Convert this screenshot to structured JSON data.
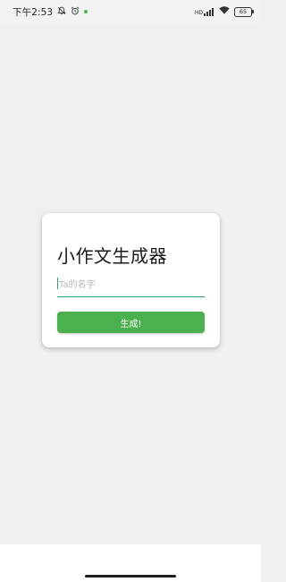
{
  "status_bar": {
    "time": "下午2:53",
    "network_label": "HD",
    "battery_level": "65",
    "icons": [
      "mute-bell-icon",
      "alarm-icon",
      "notification-dot-icon",
      "signal-icon",
      "wifi-icon",
      "battery-icon"
    ],
    "dot_color": "#4caf50"
  },
  "card": {
    "title": "小作文生成器",
    "input": {
      "value": "",
      "placeholder": "Ta的名字"
    },
    "button_label": "生成!"
  },
  "colors": {
    "accent": "#2e9e7b",
    "button": "#4caf50",
    "background": "#f0f0f0"
  }
}
